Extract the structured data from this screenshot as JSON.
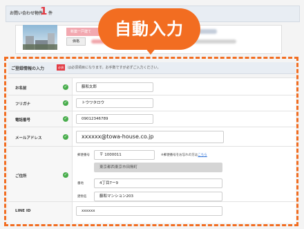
{
  "inquiry": {
    "title": "お問い合わせ物件",
    "count": "1",
    "unit": "件",
    "property_type": "新築一戸建て",
    "row_label": "価格"
  },
  "callout": "自動入力",
  "form": {
    "title": "ご登録情報の入力",
    "required_badge": "必須",
    "required_note": "は必須項目になります。お手数ですが必ずご入力ください。",
    "fields": {
      "name": {
        "label": "お名前",
        "value": "藤和太郎"
      },
      "kana": {
        "label": "フリガナ",
        "value": "トウワタロウ"
      },
      "phone": {
        "label": "電話番号",
        "value": "09012346789"
      },
      "email": {
        "label": "メールアドレス",
        "value": "xxxxxx@towa-house.co.jp"
      },
      "address": {
        "label": "ご住所",
        "postal_label": "郵便番号",
        "postal_value": "〒 1000011",
        "postal_note": "※郵便番号をお忘れの方は",
        "postal_link": "こちら",
        "prefecture_city": "東京都西東京市田無町",
        "street_label": "番地",
        "street_value": "4丁目7ー9",
        "building_label": "建物名",
        "building_value": "藤和マンション203"
      },
      "line": {
        "label": "LINE ID",
        "value": "xxxxxx"
      }
    }
  }
}
